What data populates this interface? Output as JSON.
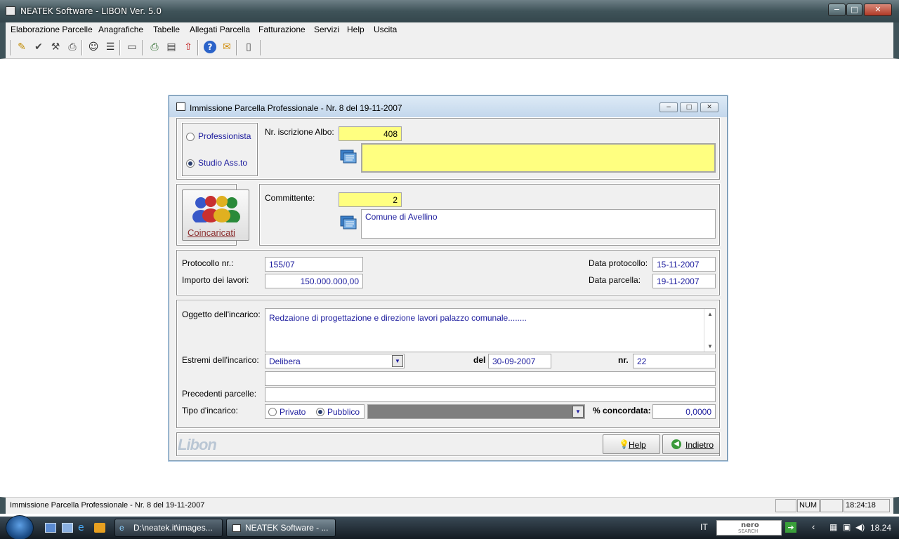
{
  "app": {
    "title": "NEATEK Software  -  LIBON Ver. 5.0",
    "window_controls": {
      "minimize": "−",
      "maximize": "□",
      "close": "✕"
    }
  },
  "menu": [
    "Elaborazione Parcelle",
    "Anagrafiche",
    "Tabelle",
    "Allegati Parcella",
    "Fatturazione",
    "Servizi",
    "Help",
    "Uscita"
  ],
  "toolbar": {
    "icons": [
      "edit-icon",
      "checklist-icon",
      "tools-icon",
      "print-icon",
      "users-icon",
      "report-icon",
      "window-icon",
      "printer-icon",
      "document-icon",
      "export-icon",
      "help-icon",
      "mail-icon",
      "exit-icon"
    ],
    "glyphs": [
      "✎",
      "✔",
      "⚒",
      "⎙",
      "☺",
      "☰",
      "▭",
      "⎙",
      "▤",
      "⇧",
      "?",
      "✉",
      "▯"
    ]
  },
  "dialog": {
    "title": "Immissione Parcella Professionale - Nr. 8  del 19-11-2007",
    "professional_type": {
      "options": [
        "Professionista",
        "Studio Ass.to"
      ],
      "selected": "Studio Ass.to"
    },
    "albo": {
      "label": "Nr. iscrizione Albo:",
      "value": "408",
      "name": ""
    },
    "coincaricati_label": "Coincaricati",
    "committente": {
      "label": "Committente:",
      "value": "2",
      "name": "Comune di Avellino"
    },
    "protocollo": {
      "label": "Protocollo nr.:",
      "value": "155/07"
    },
    "importo": {
      "label": "Importo dei lavori:",
      "value": "150.000.000,00"
    },
    "data_protocollo": {
      "label": "Data protocollo:",
      "value": "15-11-2007"
    },
    "data_parcella": {
      "label": "Data parcella:",
      "value": "19-11-2007"
    },
    "oggetto": {
      "label": "Oggetto dell'incarico:",
      "value": "Redzaione di progettazione e direzione lavori palazzo comunale........"
    },
    "estremi": {
      "label": "Estremi dell'incarico:",
      "value": "Delibera",
      "del_label": "del",
      "del_value": "30-09-2007",
      "nr_label": "nr.",
      "nr_value": "22",
      "extra": ""
    },
    "precedenti": {
      "label": "Precedenti parcelle:",
      "value": ""
    },
    "tipo": {
      "label": "Tipo d'incarico:",
      "options": [
        "Privato",
        "Pubblico"
      ],
      "selected": "Pubblico",
      "category": ""
    },
    "concordata": {
      "label": "% concordata:",
      "value": "0,0000"
    },
    "logo": "Libon",
    "buttons": {
      "help": "Help",
      "back": "Indietro"
    }
  },
  "status": {
    "text": "Immissione Parcella Professionale - Nr. 8  del 19-11-2007",
    "num": "NUM",
    "time": "18:24:18"
  },
  "taskbar": {
    "tasks": [
      "D:\\neatek.it\\images...",
      "NEATEK Software  - ..."
    ],
    "lang": "IT",
    "search_brand": "nero",
    "search_sub": "SEARCH",
    "clock": "18.24"
  },
  "colors": {
    "field_highlight": "#ffff80",
    "value_text": "#1d1d9e",
    "titlebar": "#3f5359"
  }
}
